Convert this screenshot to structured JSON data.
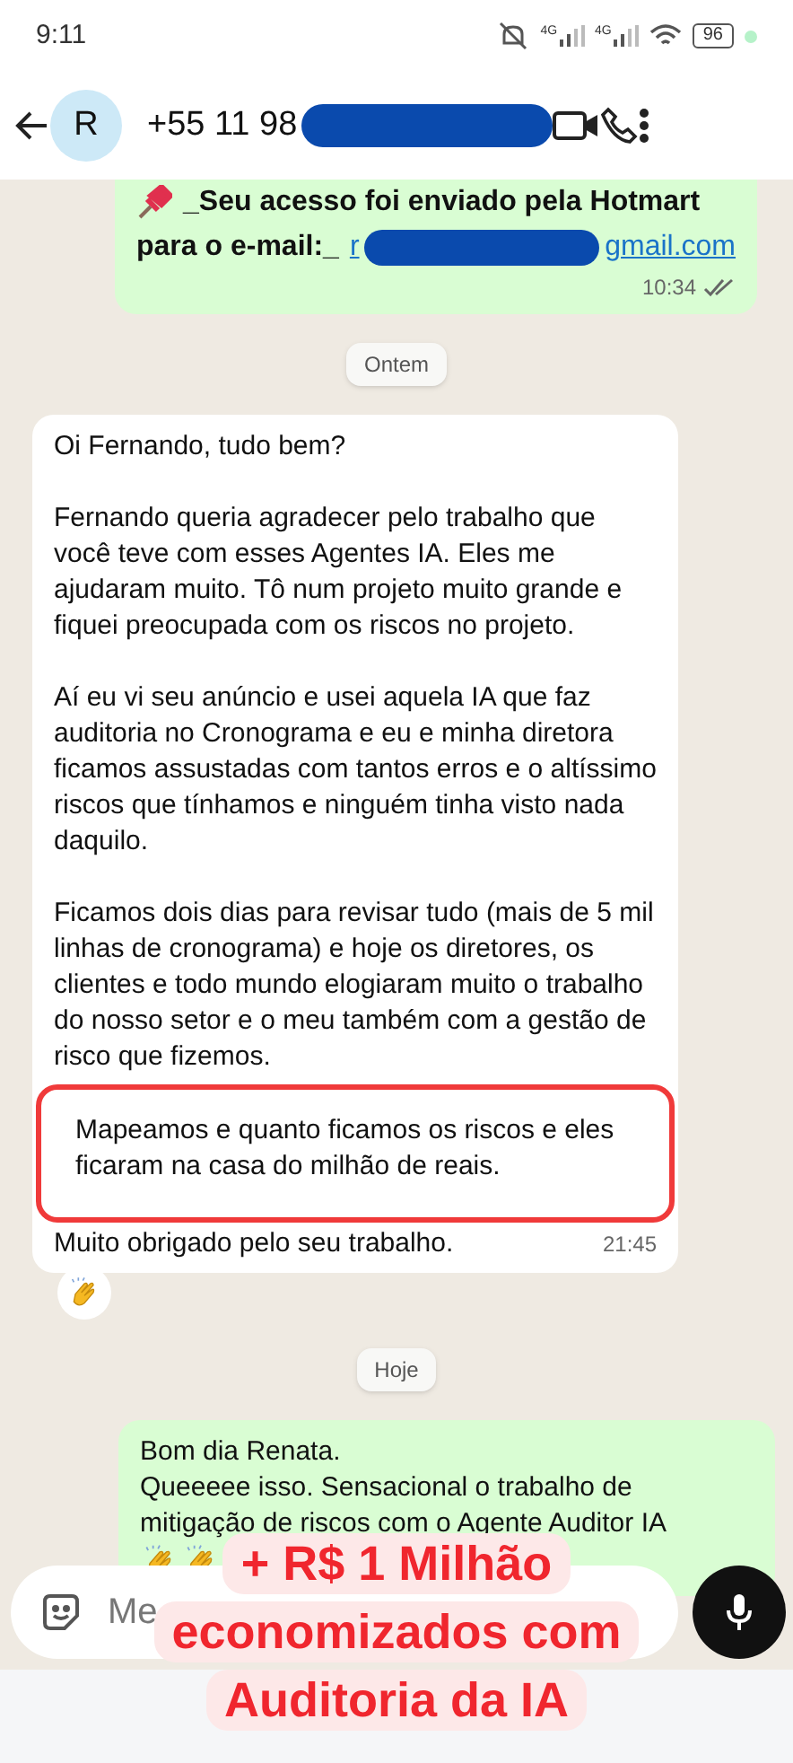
{
  "status_bar": {
    "time": "9:11",
    "network_1": "4G",
    "network_2": "4G",
    "battery": "96"
  },
  "header": {
    "avatar_letter": "R",
    "contact": "+55 11 98"
  },
  "messages": [
    {
      "kind": "outgoing",
      "title": "_Seu acesso foi enviado pela Hotmart",
      "email_label": "para o e-mail:_",
      "email_start": "r",
      "email_end": "gmail.com",
      "time": "10:34",
      "read": true
    },
    {
      "kind": "date",
      "text": "Ontem"
    },
    {
      "kind": "incoming",
      "paragraphs": [
        "Oi Fernando, tudo bem?",
        "Fernando queria agradecer pelo trabalho que você teve com esses Agentes IA. Eles me ajudaram muito. Tô num projeto muito grande e fiquei preocupada com os riscos no projeto.",
        "Aí eu vi seu anúncio e usei aquela IA que faz auditoria no Cronograma e eu e minha diretora ficamos assustadas com tantos erros e o altíssimo riscos que tínhamos e ninguém tinha visto nada daquilo.",
        "Ficamos dois dias para revisar tudo (mais de 5 mil linhas de cronograma) e hoje os diretores, os clientes e todo mundo elogiaram muito o trabalho do nosso setor e o meu também com a gestão de risco que fizemos."
      ],
      "highlight": "Mapeamos e quanto ficamos os riscos e eles ficaram na casa do milhão de reais.",
      "last_line": "Muito obrigado pelo seu trabalho.",
      "time": "21:45",
      "reaction": true
    },
    {
      "kind": "date",
      "text": "Hoje"
    },
    {
      "kind": "outgoing_text",
      "lines": [
        "Bom dia Renata.",
        "Queeeee isso. Sensacional o trabalho de mitigação de riscos com o Agente Auditor IA"
      ],
      "reactions_inline": true
    }
  ],
  "composer": {
    "placeholder": "Me"
  },
  "promo": {
    "lines": [
      "+ R$ 1 Milhão",
      "economizados com",
      "Auditoria da IA"
    ]
  }
}
